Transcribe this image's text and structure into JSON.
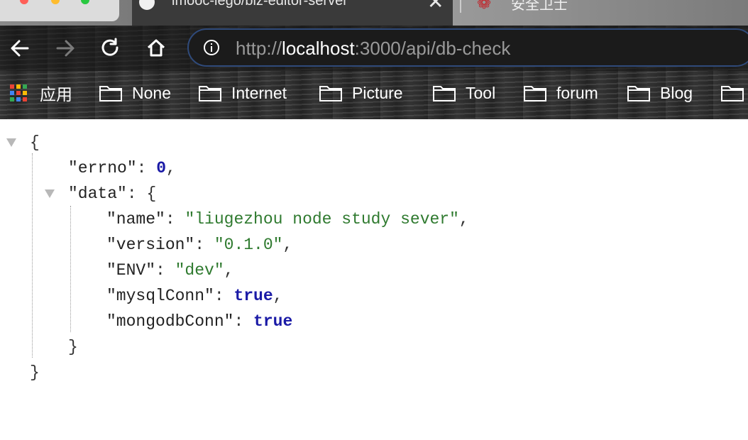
{
  "tabs": [
    {
      "title": "imooc-lego/biz-editor-server",
      "close": "✕",
      "icon": "github-icon"
    },
    {
      "title": "安全卫士",
      "icon": "brand-icon"
    }
  ],
  "toolbar": {
    "back": "back-arrow-icon",
    "forward": "forward-arrow-icon",
    "reload": "reload-icon",
    "home": "home-icon"
  },
  "address": {
    "scheme": "http://",
    "host": "localhost",
    "path": ":3000/api/db-check"
  },
  "bookmarks": {
    "apps_label": "应用",
    "items": [
      "None",
      "Internet",
      "Picture",
      "Tool",
      "forum",
      "Blog"
    ]
  },
  "json": {
    "open_brace": "{",
    "close_brace": "}",
    "errno_key": "\"errno\"",
    "errno_value": "0",
    "data_key": "\"data\"",
    "name_key": "\"name\"",
    "name_value": "\"liugezhou node study sever\"",
    "version_key": "\"version\"",
    "version_value": "\"0.1.0\"",
    "env_key": "\"ENV\"",
    "env_value": "\"dev\"",
    "mysql_key": "\"mysqlConn\"",
    "mysql_value": "true",
    "mongo_key": "\"mongodbConn\"",
    "mongo_value": "true",
    "colon": ": ",
    "comma": ","
  },
  "colors": {
    "string": "#2f7a2f",
    "number": "#1a1aa6",
    "boolean": "#1a1aa6"
  }
}
